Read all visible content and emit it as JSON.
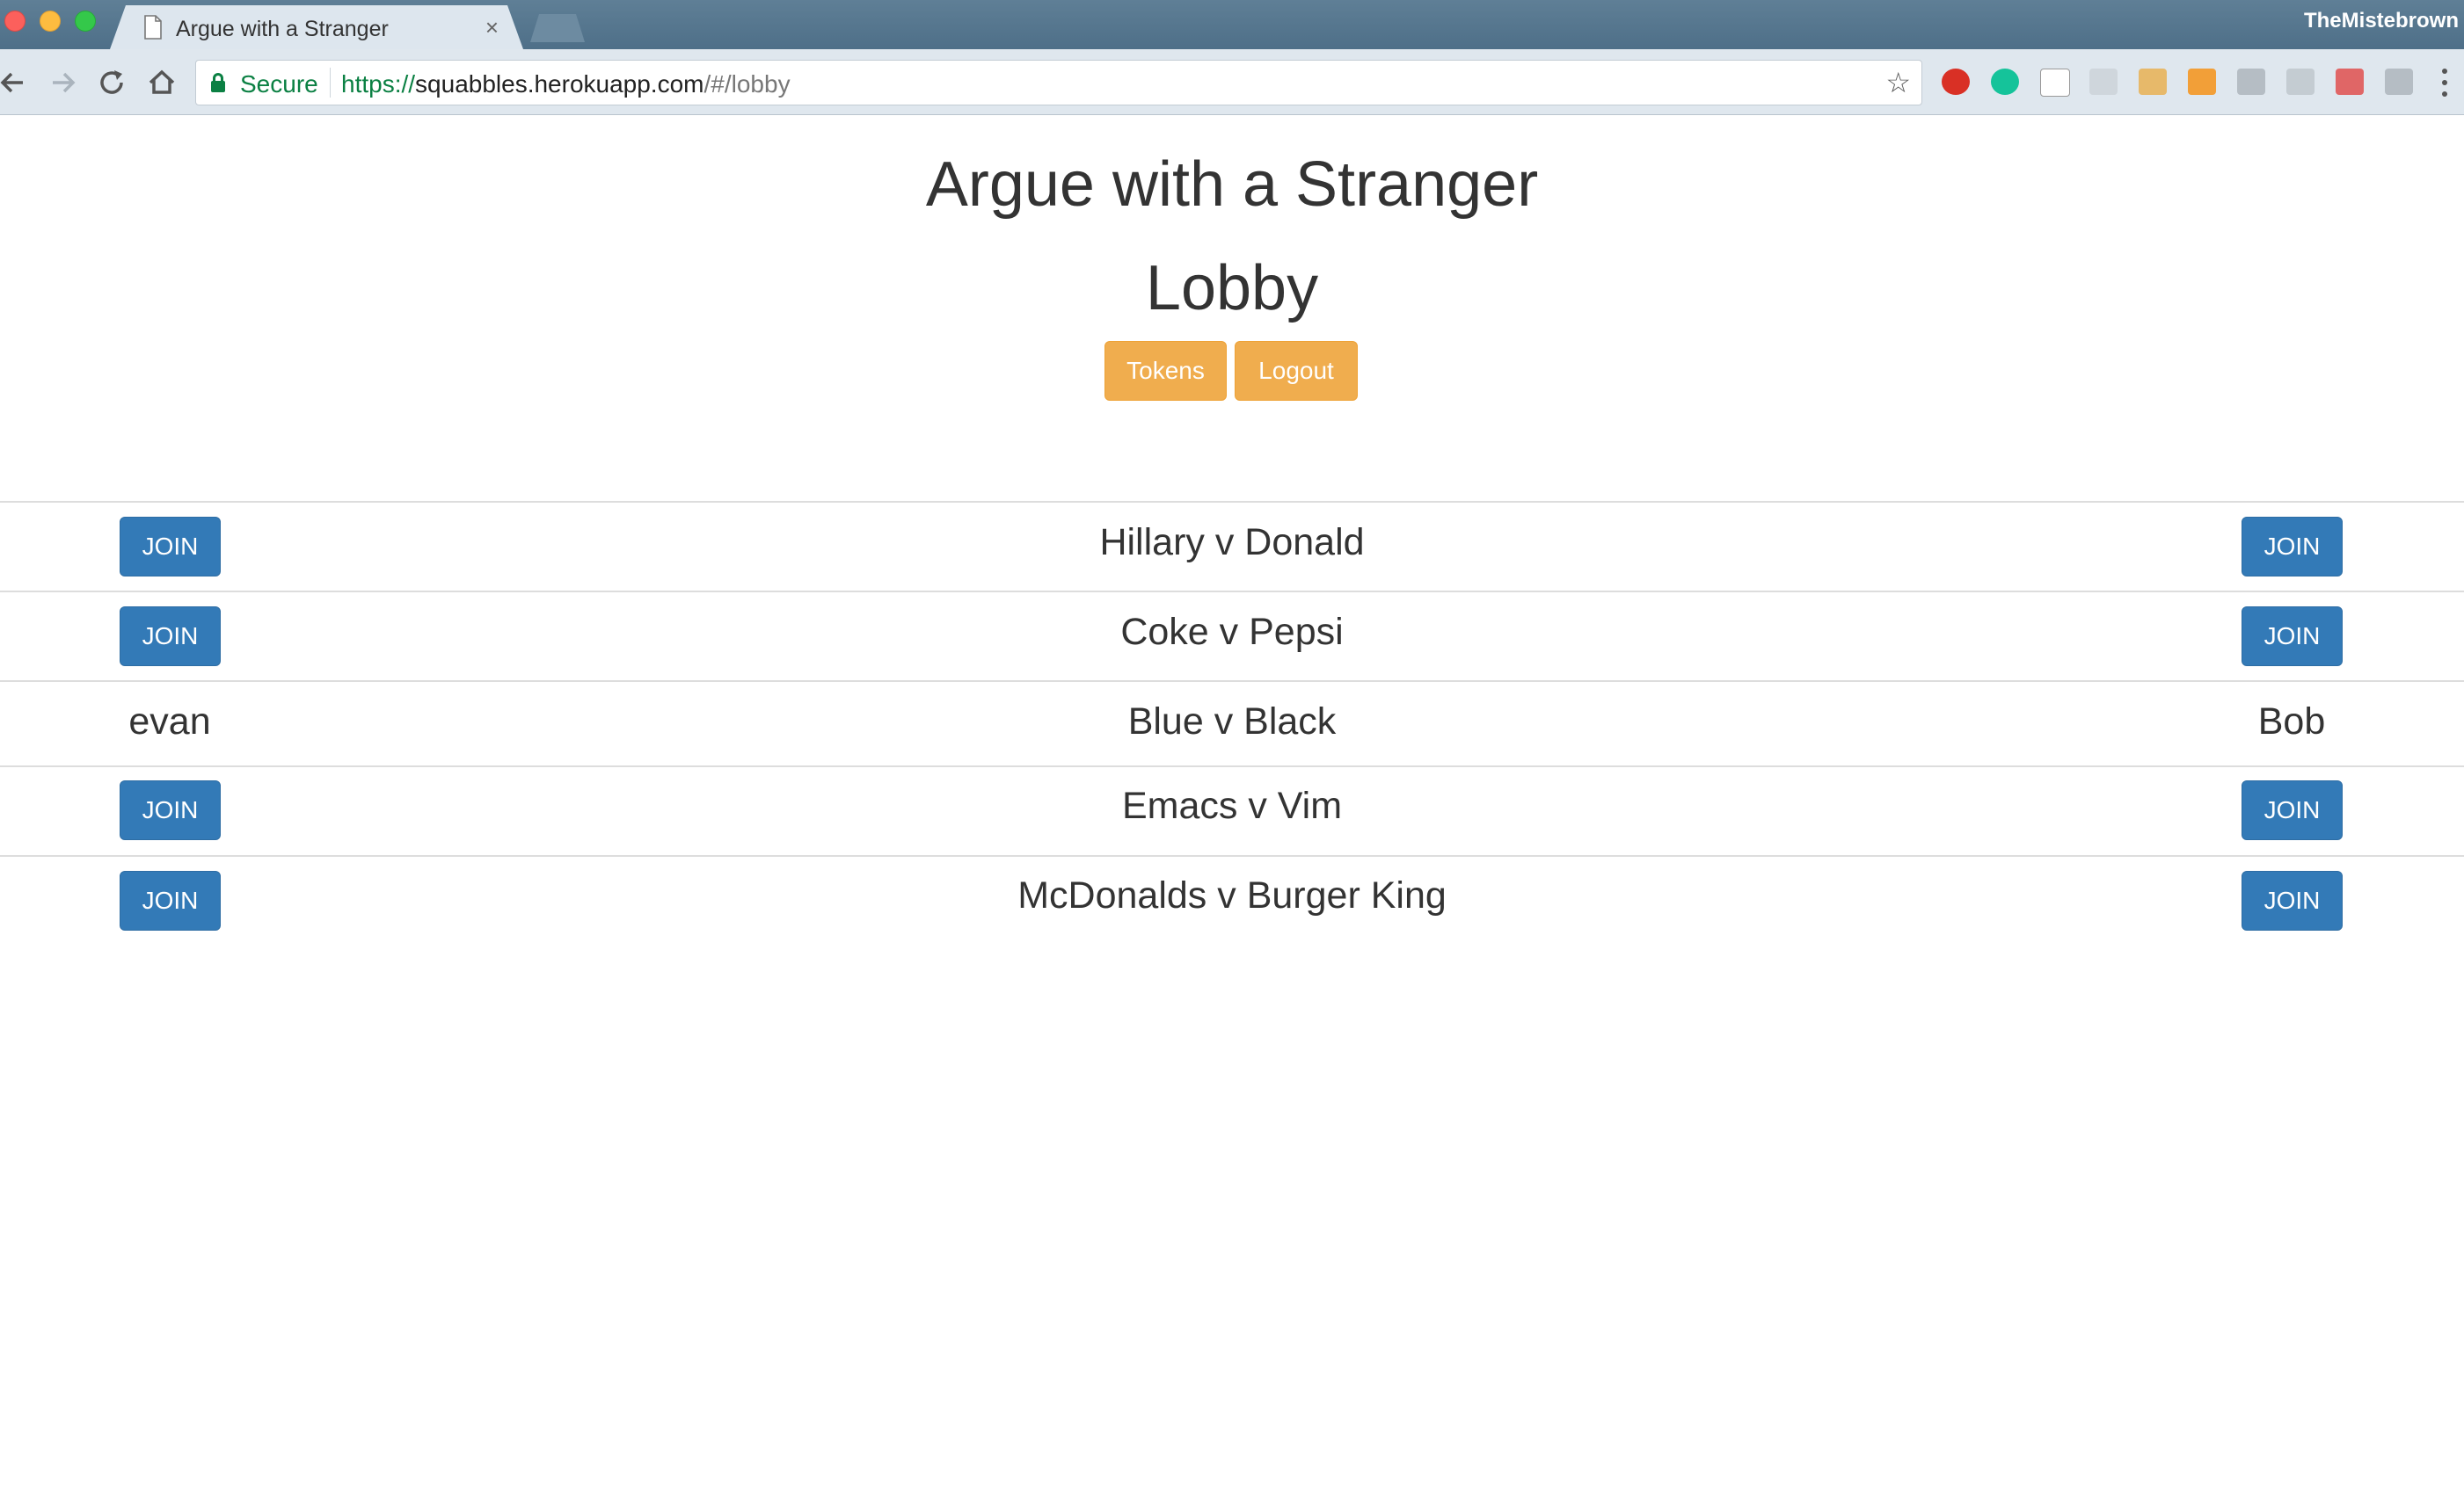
{
  "browser": {
    "tab_title": "Argue with a Stranger",
    "tab_close": "×",
    "profile_name": "TheMistebrown",
    "security_label": "Secure",
    "url_scheme": "https://",
    "url_host": "squabbles.herokuapp.com",
    "url_path": "/#/lobby",
    "extensions": [
      "adblock-plus-icon",
      "grammarly-icon",
      "extension-icon",
      "extension-icon",
      "extension-icon",
      "extension-icon",
      "extension-icon",
      "extension-icon",
      "extension-icon",
      "extension-icon"
    ]
  },
  "page": {
    "title": "Argue with a Stranger",
    "subtitle": "Lobby",
    "buttons": {
      "tokens": "Tokens",
      "logout": "Logout"
    },
    "rooms": [
      {
        "topic": "Hillary v Donald",
        "left": "JOIN",
        "right": "JOIN"
      },
      {
        "topic": "Coke v Pepsi",
        "left": "JOIN",
        "right": "JOIN"
      },
      {
        "topic": "Blue v Black",
        "left": "evan",
        "right": "Bob"
      },
      {
        "topic": "Emacs v Vim",
        "left": "JOIN",
        "right": "JOIN"
      },
      {
        "topic": "McDonalds v Burger King",
        "left": "JOIN",
        "right": "JOIN"
      }
    ]
  },
  "colors": {
    "join_button": "#337ab7",
    "warning_button": "#f0ad4e",
    "secure_green": "#0b8043"
  }
}
